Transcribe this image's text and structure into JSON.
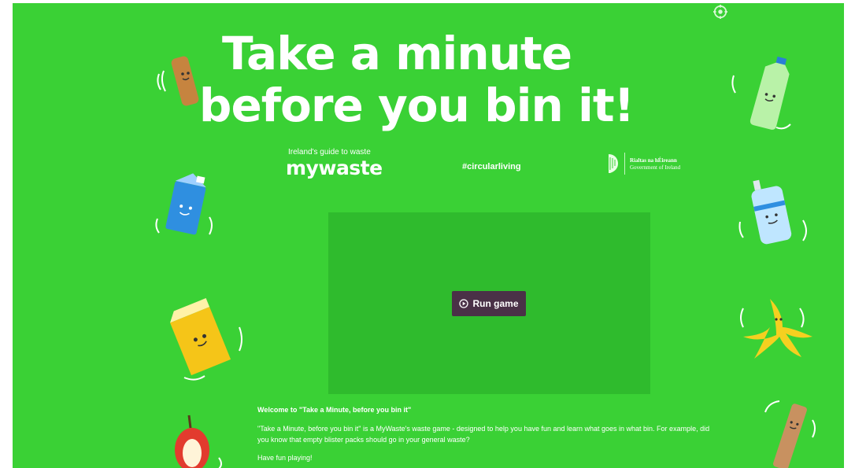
{
  "headline": {
    "line1": "Take a minute",
    "line2": "before you bin it!"
  },
  "branding": {
    "tagline": "Ireland's guide to waste",
    "logo": "mywaste",
    "hashtag": "#circularliving",
    "gov_line1": "Rialtas na hÉireann",
    "gov_line2": "Government of Ireland"
  },
  "game": {
    "run_label": "Run game"
  },
  "description": {
    "title": "Welcome to \"Take a Minute, before you bin it\"",
    "body": "\"Take a Minute, before you bin it\" is a MyWaste's waste game - designed to help you have fun and learn what goes in what bin. For example, did you know that empty blister packs should go in your general waste?",
    "closing": "Have fun playing!"
  },
  "colors": {
    "background": "#3ad135",
    "game_area": "#2fbb2d",
    "button": "#4a3147",
    "text": "#ffffff"
  },
  "icons": [
    "settings-icon",
    "play-icon",
    "harp-icon"
  ]
}
